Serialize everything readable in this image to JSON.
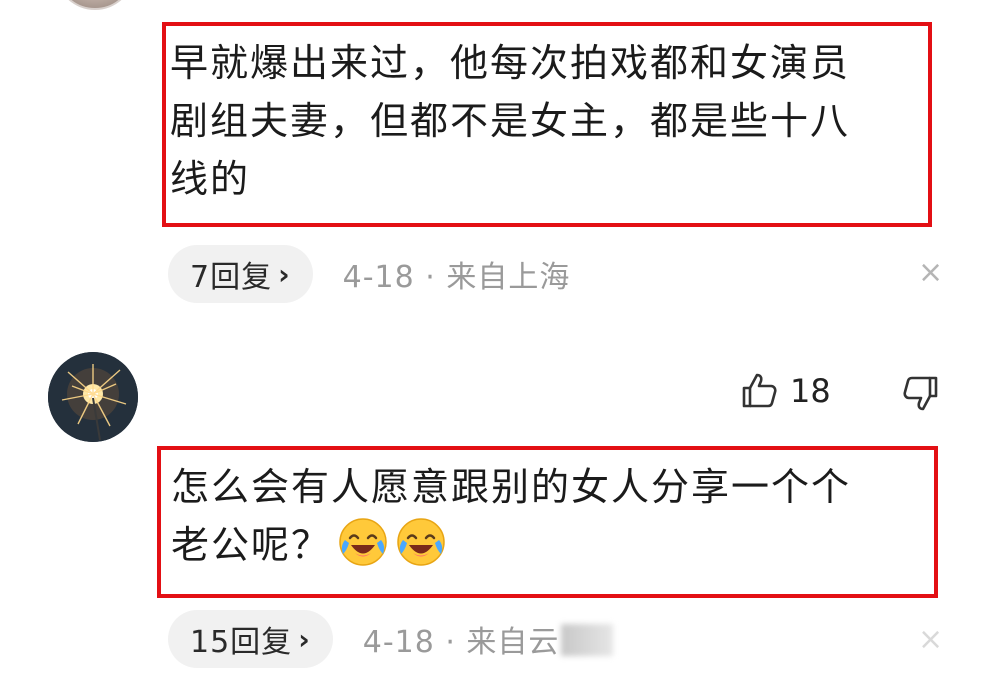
{
  "comments": [
    {
      "text": "早就爆出来过，他每次拍戏都和女演员\n剧组夫妻，但都不是女主，都是些十八\n线的",
      "reply_count": "7回复",
      "meta": "4-18 · 来自上海"
    },
    {
      "text": "怎么会有人愿意跟别的女人分享一个个\n老公呢？",
      "emojis": [
        "laugh-cry-emoji",
        "laugh-cry-emoji"
      ],
      "like_count": "18",
      "reply_count": "15回复",
      "meta": "4-18 · 来自云"
    }
  ],
  "icons": {
    "reply_chevron": "›",
    "close": "×",
    "like": "thumbs-up-icon",
    "dislike": "thumbs-down-icon"
  },
  "colors": {
    "highlight_border": "#e30f14",
    "meta_gray": "#9a9a9a",
    "pill_bg": "#f1f1f1"
  }
}
